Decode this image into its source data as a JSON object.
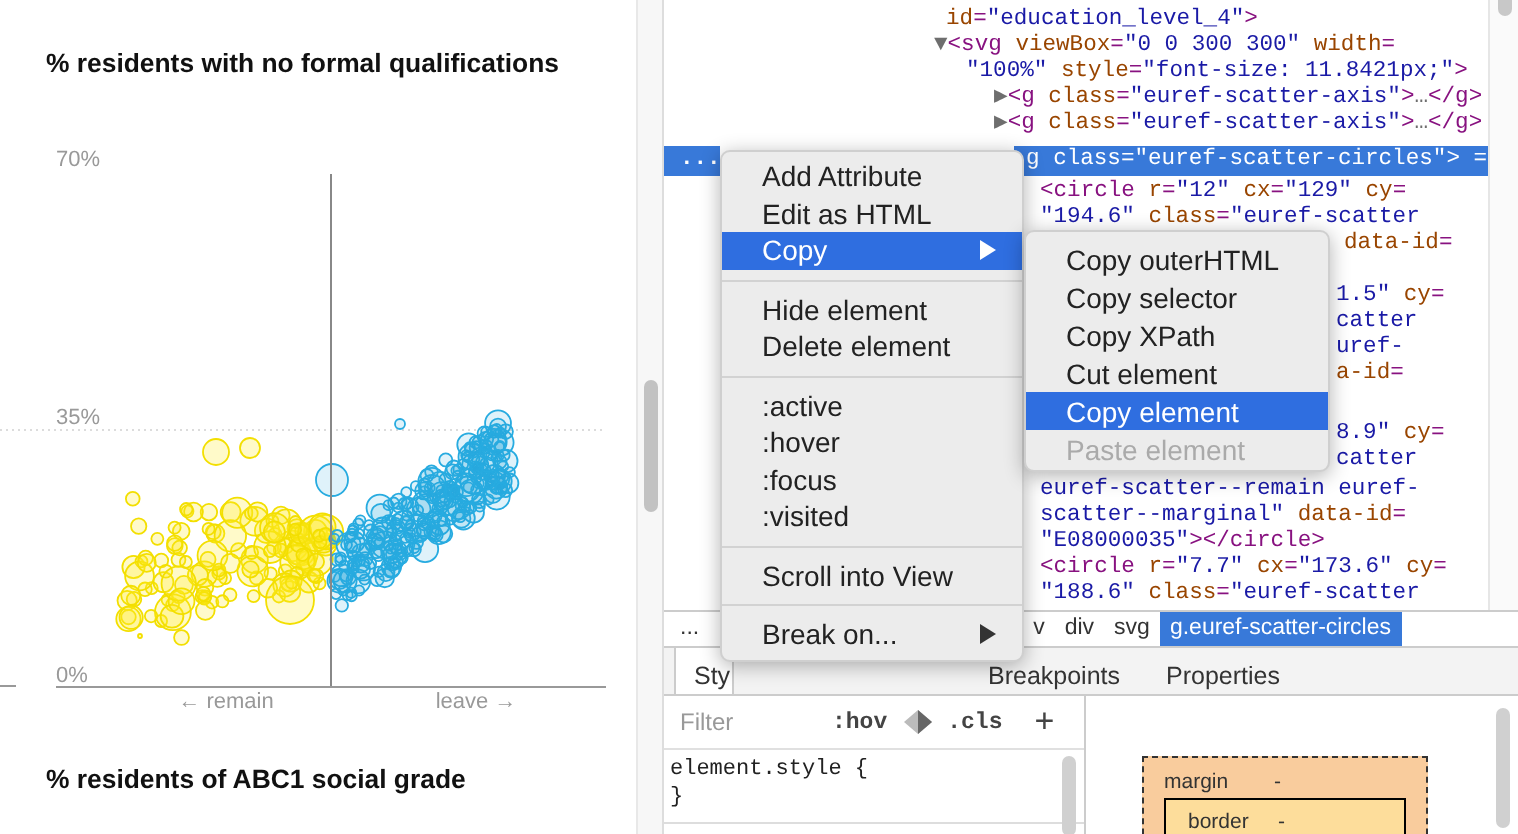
{
  "article": {
    "chart_title": "% residents with no formal qualifications",
    "y_ticks": [
      "70%",
      "35%",
      "0%"
    ],
    "x_labels": [
      "← remain",
      "leave →"
    ],
    "next_chart_title": "% residents of ABC1 social grade"
  },
  "dom_tree": {
    "rows": [
      {
        "text": "id=\"education_level_4\">",
        "selected": false
      },
      {
        "text": "▼<svg viewBox=\"0 0 300 300\" width=",
        "selected": false
      },
      {
        "text": "\"100%\" style=\"font-size: 11.8421px;\">",
        "selected": false
      },
      {
        "text": "▶<g class=\"euref-scatter-axis\">…</g>",
        "selected": false
      },
      {
        "text": "▶<g class=\"euref-scatter-axis\">…</g>",
        "selected": false
      },
      {
        "text": "g class=\"euref-scatter-circles\"> =",
        "selected": true,
        "dots": "..."
      },
      {
        "text": "<circle r=\"12\" cx=\"129\" cy=",
        "selected": false
      },
      {
        "text": "\"194.6\" class=\"euref-scatter",
        "selected": false
      },
      {
        "text": "data-id=",
        "selected": false
      },
      {
        "text": "1.5\" cy=",
        "selected": false
      },
      {
        "text": "catter",
        "selected": false
      },
      {
        "text": "uref-",
        "selected": false
      },
      {
        "text": "a-id=",
        "selected": false
      },
      {
        "text": "8.9\" cy=",
        "selected": false
      },
      {
        "text": "catter",
        "selected": false
      },
      {
        "text": "euref-scatter--remain euref-",
        "selected": false
      },
      {
        "text": "scatter--marginal\" data-id=",
        "selected": false
      },
      {
        "text": "\"E08000035\"></circle>",
        "selected": false
      },
      {
        "text": "<circle r=\"7.7\" cx=\"173.6\" cy=",
        "selected": false
      },
      {
        "text": "\"188.6\" class=\"euref-scatter",
        "selected": false
      }
    ]
  },
  "context_menu": {
    "groups": [
      {
        "items": [
          {
            "label": "Add Attribute",
            "highlighted": false,
            "has_submenu": false
          },
          {
            "label": "Edit as HTML",
            "highlighted": false,
            "has_submenu": false
          },
          {
            "label": "Copy",
            "highlighted": true,
            "has_submenu": true
          }
        ]
      },
      {
        "items": [
          {
            "label": "Hide element",
            "highlighted": false,
            "has_submenu": false
          },
          {
            "label": "Delete element",
            "highlighted": false,
            "has_submenu": false
          }
        ]
      },
      {
        "items": [
          {
            "label": ":active",
            "highlighted": false,
            "has_submenu": false
          },
          {
            "label": ":hover",
            "highlighted": false,
            "has_submenu": false
          },
          {
            "label": ":focus",
            "highlighted": false,
            "has_submenu": false
          },
          {
            "label": ":visited",
            "highlighted": false,
            "has_submenu": false
          }
        ]
      },
      {
        "items": [
          {
            "label": "Scroll into View",
            "highlighted": false,
            "has_submenu": false
          }
        ]
      },
      {
        "items": [
          {
            "label": "Break on...",
            "highlighted": false,
            "has_submenu": true
          }
        ]
      }
    ]
  },
  "submenu": {
    "items": [
      {
        "label": "Copy outerHTML",
        "highlighted": false,
        "disabled": false
      },
      {
        "label": "Copy selector",
        "highlighted": false,
        "disabled": false
      },
      {
        "label": "Copy XPath",
        "highlighted": false,
        "disabled": false
      },
      {
        "label": "Cut element",
        "highlighted": false,
        "disabled": false
      },
      {
        "label": "Copy element",
        "highlighted": true,
        "disabled": false
      },
      {
        "label": "Paste element",
        "highlighted": false,
        "disabled": true
      }
    ]
  },
  "breadcrumbs": [
    {
      "label": "...",
      "selected": false
    },
    {
      "label": "v",
      "selected": false
    },
    {
      "label": "div",
      "selected": false
    },
    {
      "label": "svg",
      "selected": false
    },
    {
      "label": "g.euref-scatter-circles",
      "selected": true
    }
  ],
  "panel_tabs": [
    {
      "label": "Sty",
      "selected": true
    },
    {
      "label": "Breakpoints",
      "selected": false
    },
    {
      "label": "Properties",
      "selected": false
    }
  ],
  "styles_pane": {
    "filter": {
      "placeholder": "Filter"
    },
    "toolbar": [
      ":hov",
      ".cls",
      "+"
    ],
    "rules": [
      "element.style {",
      "}"
    ]
  },
  "box_model": {
    "margin": {
      "label": "margin",
      "value": "-"
    },
    "border": {
      "label": "border",
      "value": "-"
    }
  }
}
